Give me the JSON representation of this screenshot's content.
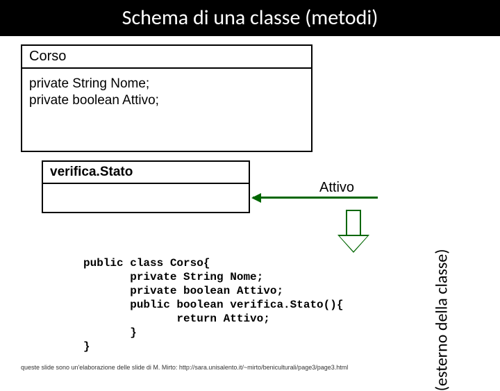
{
  "title": "Schema di una classe (metodi)",
  "classBox": {
    "name": "Corso",
    "attrs": "private String Nome;\nprivate boolean Attivo;"
  },
  "methodBox": {
    "name": "verifica.Stato"
  },
  "attivoLabel": "Attivo",
  "sideLabel": "(esterno della classe)",
  "code": "public class Corso{\n       private String Nome;\n       private boolean Attivo;\n       public boolean verifica.Stato(){\n              return Attivo;\n       }\n}",
  "footer": "queste slide sono un'elaborazione delle slide di M. Mirto: http://sara.unisalento.it/~mirto/beniculturali/page3/page3.html"
}
